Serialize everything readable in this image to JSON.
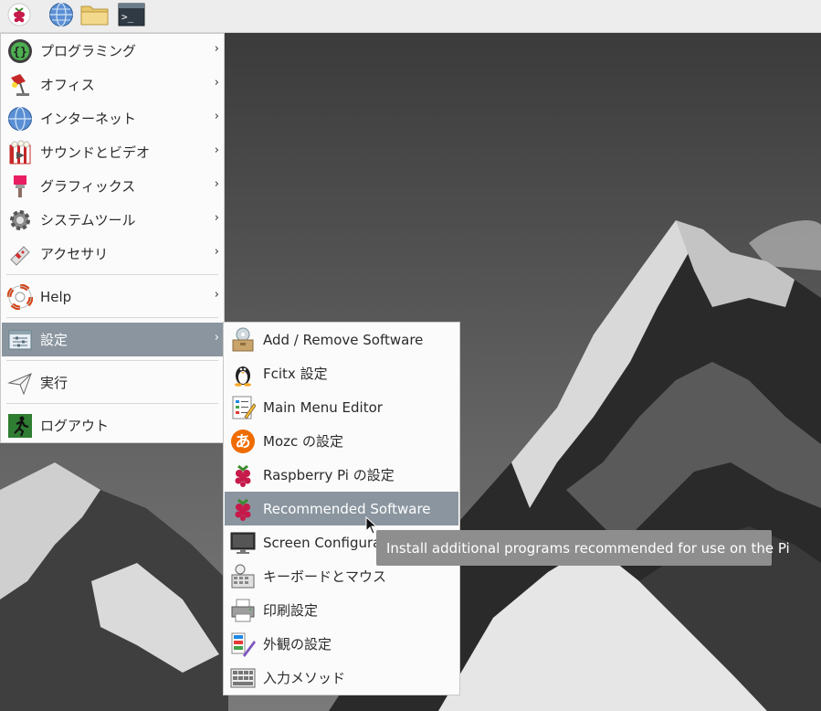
{
  "panel": {
    "launchers": [
      "raspberry-menu",
      "web-browser",
      "file-manager",
      "terminal"
    ]
  },
  "main_menu": {
    "items": [
      {
        "label": "プログラミング",
        "icon": "programming-icon"
      },
      {
        "label": "オフィス",
        "icon": "office-icon"
      },
      {
        "label": "インターネット",
        "icon": "internet-icon"
      },
      {
        "label": "サウンドとビデオ",
        "icon": "sound-video-icon"
      },
      {
        "label": "グラフィックス",
        "icon": "graphics-icon"
      },
      {
        "label": "システムツール",
        "icon": "system-tools-icon"
      },
      {
        "label": "アクセサリ",
        "icon": "accessories-icon"
      },
      {
        "label": "Help",
        "icon": "help-icon"
      },
      {
        "label": "設定",
        "icon": "preferences-icon"
      },
      {
        "label": "実行",
        "icon": "run-icon"
      },
      {
        "label": "ログアウト",
        "icon": "logout-icon"
      }
    ],
    "selected": "設定"
  },
  "sub_menu": {
    "items": [
      {
        "label": "Add / Remove Software",
        "icon": "package-icon"
      },
      {
        "label": "Fcitx 設定",
        "icon": "penguin-icon"
      },
      {
        "label": "Main Menu Editor",
        "icon": "menu-editor-icon"
      },
      {
        "label": "Mozc の設定",
        "icon": "mozc-icon"
      },
      {
        "label": "Raspberry Pi の設定",
        "icon": "raspberry-icon"
      },
      {
        "label": "Recommended Software",
        "icon": "raspberry-icon"
      },
      {
        "label": "Screen Configurat",
        "icon": "monitor-icon"
      },
      {
        "label": "キーボードとマウス",
        "icon": "keyboard-mouse-icon"
      },
      {
        "label": "印刷設定",
        "icon": "printer-icon"
      },
      {
        "label": "外観の設定",
        "icon": "appearance-icon"
      },
      {
        "label": "入力メソッド",
        "icon": "input-method-icon"
      }
    ],
    "selected": "Recommended Software"
  },
  "tooltip": {
    "text": "Install additional programs recommended for use on the Pi"
  },
  "colors": {
    "menu_bg": "#fbfbfb",
    "selection": "#8a959f",
    "tooltip_bg": "#8e8e8e",
    "panel_bg": "#ededed"
  }
}
